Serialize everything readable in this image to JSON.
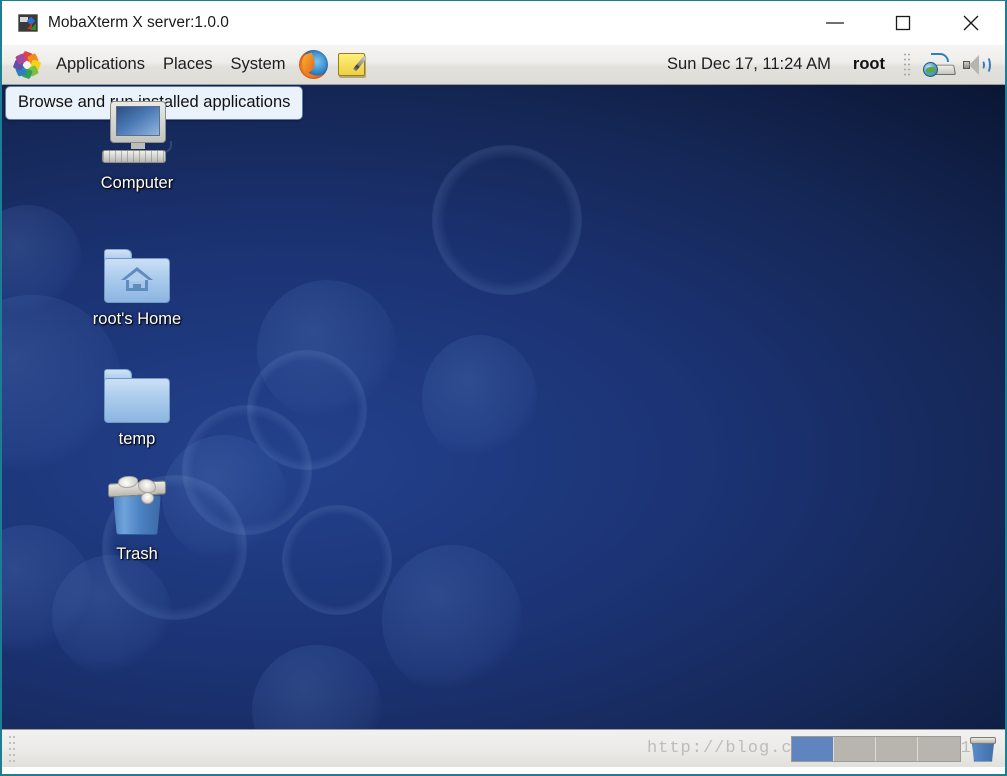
{
  "window": {
    "title": "MobaXterm X server:1.0.0",
    "icon": "mobaxterm-icon",
    "controls": {
      "minimize": "minimize-button",
      "maximize": "maximize-button",
      "close": "close-button"
    }
  },
  "top_panel": {
    "applications_icon": "applications-menu-icon",
    "menus": [
      {
        "label": "Applications",
        "name": "menu-applications"
      },
      {
        "label": "Places",
        "name": "menu-places"
      },
      {
        "label": "System",
        "name": "menu-system"
      }
    ],
    "launchers": [
      {
        "name": "firefox-launcher-icon",
        "title": "Firefox Web Browser"
      },
      {
        "name": "text-editor-launcher-icon",
        "title": "Text Editor"
      }
    ],
    "clock": "Sun Dec 17, 11:24 AM",
    "user": "root",
    "tray": [
      {
        "name": "network-keyboard-icon"
      },
      {
        "name": "volume-speaker-icon"
      }
    ]
  },
  "tooltip": {
    "text": "Browse and run installed applications"
  },
  "desktop": {
    "icons": [
      {
        "label": "Computer",
        "name": "desktop-icon-computer",
        "glyph": "computer-icon"
      },
      {
        "label": "root's Home",
        "name": "desktop-icon-root-home",
        "glyph": "home-folder-icon"
      },
      {
        "label": "temp",
        "name": "desktop-icon-temp",
        "glyph": "folder-icon"
      },
      {
        "label": "Trash",
        "name": "desktop-icon-trash",
        "glyph": "trash-icon"
      }
    ]
  },
  "bottom_panel": {
    "watermark": "http://blog.csdn.net/juyin2015",
    "workspaces": [
      {
        "name": "workspace-1",
        "active": true
      },
      {
        "name": "workspace-2",
        "active": false
      },
      {
        "name": "workspace-3",
        "active": false
      },
      {
        "name": "workspace-4",
        "active": false
      }
    ],
    "trash_applet": "trash-applet-icon"
  },
  "colors": {
    "window_border": "#1b7e94",
    "desktop_base": "#1b3272",
    "workspace_active": "#5e85bd",
    "tooltip_bg": "#eaf2fb"
  }
}
